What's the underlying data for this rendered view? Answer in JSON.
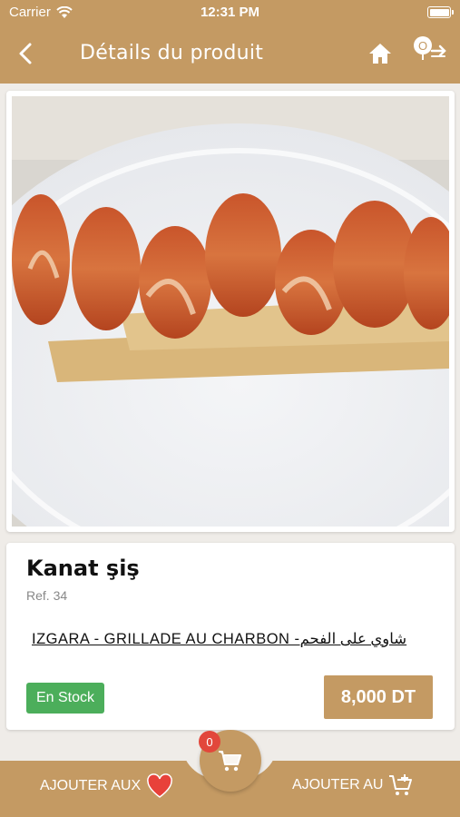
{
  "status_bar": {
    "carrier": "Carrier",
    "time": "12:31 PM"
  },
  "nav": {
    "title": "Détails du produit",
    "icons": [
      "back-chevron-icon",
      "home-icon",
      "logout-icon"
    ]
  },
  "product": {
    "name": "Kanat şiş",
    "ref": "Ref. 34",
    "description": "IZGARA - GRILLADE AU CHARBON -شاوي على الفحم",
    "stock": "En Stock",
    "price": "8,000 DT",
    "image_icon": "chicken-wings-photo"
  },
  "bottom_bar": {
    "wishlist_label": "AJOUTER AUX",
    "wishlist_icon": "heart-icon",
    "add_cart_label": "AJOUTER AU",
    "add_cart_icon": "cart-plus-icon",
    "cart_count": "0"
  },
  "colors": {
    "brand": "#c49a63",
    "stock_green": "#4cae5b",
    "badge_red": "#e2473b",
    "heart_red": "#e8413a"
  }
}
